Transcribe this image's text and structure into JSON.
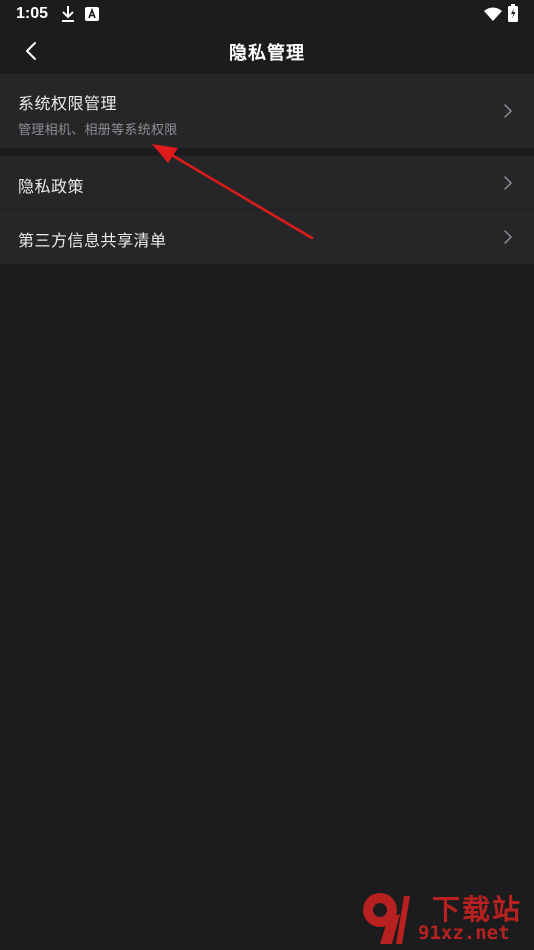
{
  "status_bar": {
    "time": "1:05",
    "icons": [
      "download-icon",
      "a-notification-icon",
      "wifi-icon",
      "battery-charging-icon"
    ]
  },
  "nav": {
    "title": "隐私管理",
    "back_icon": "back-chevron-icon"
  },
  "settings": {
    "group1": [
      {
        "title": "系统权限管理",
        "subtitle": "管理相机、相册等系统权限"
      }
    ],
    "group2": [
      {
        "title": "隐私政策"
      },
      {
        "title": "第三方信息共享清单"
      }
    ]
  },
  "watermark": {
    "logo_text": "下载站",
    "site": "91xz.net"
  },
  "colors": {
    "background": "#1c1c1e",
    "row_background": "#262628",
    "annotation_arrow": "#e01b1b",
    "watermark": "#b7211f"
  }
}
